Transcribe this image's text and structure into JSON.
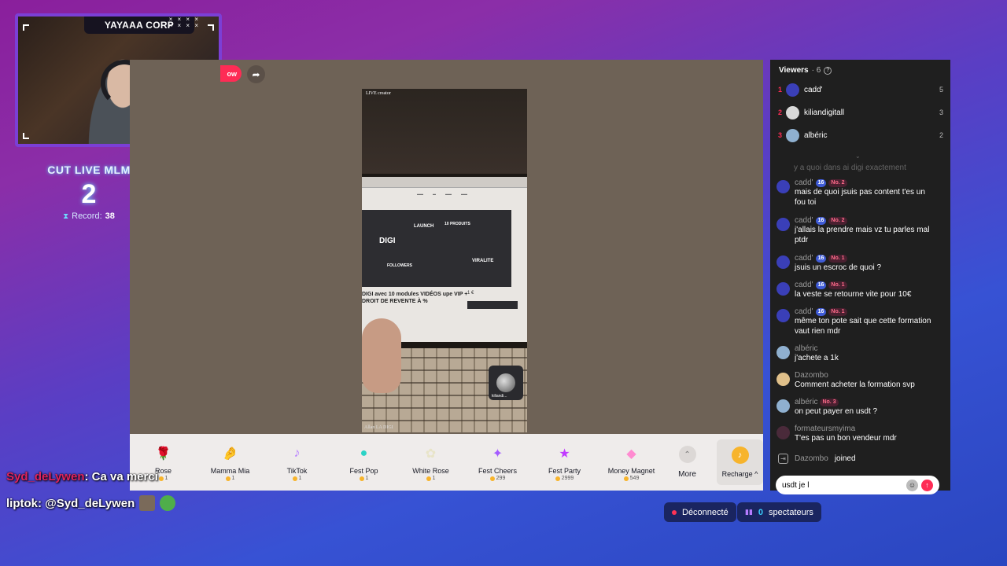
{
  "overlay": {
    "webcam_title": "YAYAAA CORP",
    "cut_live": {
      "label": "CUT LIVE MLM",
      "count": "2",
      "record_label": "Record:",
      "record_value": "38"
    },
    "chat_lines": [
      {
        "user": "Syd_deLywen",
        "text": ": Ca va merci"
      },
      {
        "user": "liptok",
        "text": ": @Syd_deLywen"
      }
    ]
  },
  "stream": {
    "follow_label": "ow",
    "phone": {
      "live_label": "LIVE creator",
      "bottom_label": "Allan LA DIGI",
      "screen": {
        "digi": "DIGI",
        "launch": "LAUNCH",
        "produits": "10 PRODUITS",
        "followers": "FOLLOWERS",
        "viralite": "VIRALITE",
        "headline": "DIGI avec 10 modules VIDÉOS upe VIP + DROIT DE REVENTE À %",
        "price": "1 €"
      },
      "pip_name": "kiliandi..."
    },
    "gifts": [
      {
        "name": "Rose",
        "price": "1",
        "icon": "rose-icon",
        "color": "#e8274b",
        "glyph": "🌹"
      },
      {
        "name": "Mamma Mia",
        "price": "1",
        "icon": "hand-icon",
        "color": "#f2b39b",
        "glyph": "🤌"
      },
      {
        "name": "TikTok",
        "price": "1",
        "icon": "tiktok-icon",
        "color": "#b983ff",
        "glyph": "♪"
      },
      {
        "name": "Fest Pop",
        "price": "1",
        "icon": "fest-pop-icon",
        "color": "#2bd3c6",
        "glyph": "●"
      },
      {
        "name": "White Rose",
        "price": "1",
        "icon": "white-rose-icon",
        "color": "#e8e4c8",
        "glyph": "✿"
      },
      {
        "name": "Fest Cheers",
        "price": "299",
        "icon": "fest-cheers-icon",
        "color": "#a45bff",
        "glyph": "✦"
      },
      {
        "name": "Fest Party",
        "price": "2999",
        "icon": "fest-party-icon",
        "color": "#c13bff",
        "glyph": "★"
      },
      {
        "name": "Money Magnet",
        "price": "549",
        "icon": "money-magnet-icon",
        "color": "#ff8bd1",
        "glyph": "◆"
      }
    ],
    "more_label": "More",
    "recharge_label": "Recharge ^"
  },
  "side": {
    "viewers_label": "Viewers",
    "viewers_count": "· 6",
    "top_viewers": [
      {
        "rank": "1",
        "name": "cadd'",
        "score": "5",
        "color": "#3a3fb8"
      },
      {
        "rank": "2",
        "name": "kiliandigitall",
        "score": "3",
        "color": "#d8d8d8"
      },
      {
        "rank": "3",
        "name": "albéric",
        "score": "2",
        "color": "#8fb0d0"
      }
    ],
    "clipped_line": "y a quoi dans ai digi exactement",
    "messages": [
      {
        "user": "cadd'",
        "lvl": "16",
        "no": "No. 2",
        "text": "mais de quoi jsuis pas content t'es un fou toi",
        "color": "#3a3fb8"
      },
      {
        "user": "cadd'",
        "lvl": "16",
        "no": "No. 2",
        "text": "j'allais la prendre mais vz tu parles mal ptdr",
        "color": "#3a3fb8"
      },
      {
        "user": "cadd'",
        "lvl": "16",
        "no": "No. 1",
        "text": "jsuis un escroc de quoi ?",
        "color": "#3a3fb8"
      },
      {
        "user": "cadd'",
        "lvl": "16",
        "no": "No. 1",
        "text": "la veste se retourne vite pour 10€",
        "color": "#3a3fb8"
      },
      {
        "user": "cadd'",
        "lvl": "16",
        "no": "No. 1",
        "text": "même ton pote sait que cette formation vaut rien mdr",
        "color": "#3a3fb8"
      },
      {
        "user": "albéric",
        "lvl": "",
        "no": "",
        "text": "j'achete a 1k",
        "color": "#8fb0d0"
      },
      {
        "user": "Dazombo",
        "lvl": "",
        "no": "",
        "text": "Comment acheter la formation svp",
        "color": "#e0c08a"
      },
      {
        "user": "albéric",
        "lvl": "",
        "no": "No. 3",
        "text": "on peut payer en usdt ?",
        "color": "#8fb0d0"
      },
      {
        "user": "formateursmyima",
        "lvl": "",
        "no": "",
        "text": "T'es pas un bon vendeur mdr",
        "color": "#4a2a3a"
      }
    ],
    "joined": {
      "user": "Dazombo",
      "action": "joined"
    },
    "input_value": "usdt je l"
  },
  "status": {
    "disconnected": "Déconnecté",
    "spectators_count": "0",
    "spectators_label": "spectateurs"
  }
}
